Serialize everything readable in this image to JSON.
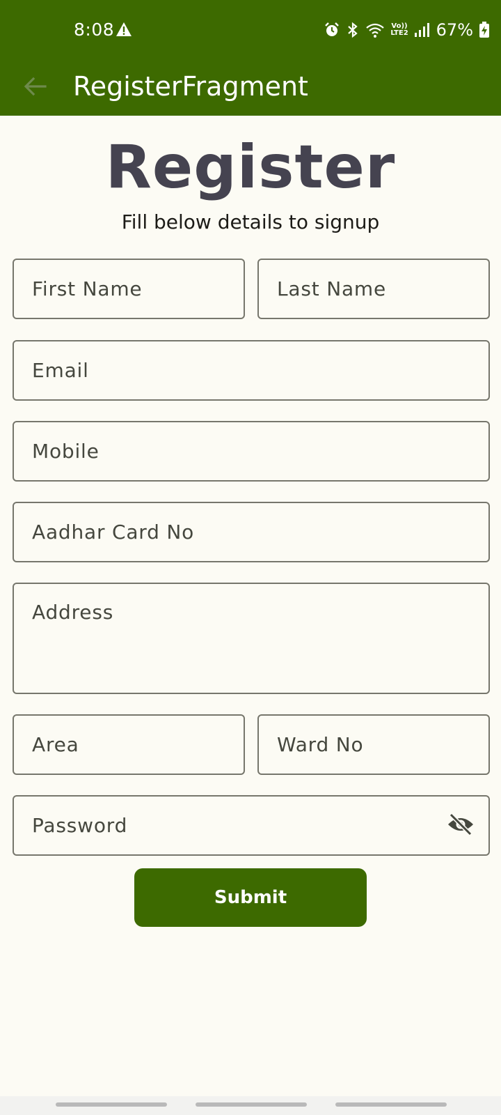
{
  "status_bar": {
    "time": "8:08",
    "battery": "67%",
    "volte_top": "Vo))",
    "volte_bottom": "LTE2"
  },
  "app_bar": {
    "title": "RegisterFragment"
  },
  "form": {
    "heading": "Register",
    "subheading": "Fill below details to signup",
    "first_name_placeholder": "First Name",
    "last_name_placeholder": "Last Name",
    "email_placeholder": "Email",
    "mobile_placeholder": "Mobile",
    "aadhar_placeholder": "Aadhar Card No",
    "address_placeholder": "Address",
    "area_placeholder": "Area",
    "ward_placeholder": "Ward No",
    "password_placeholder": "Password",
    "submit_label": "Submit"
  },
  "colors": {
    "primary": "#3d6a00",
    "background": "#fcfbf4",
    "heading": "#454350",
    "outline": "#76766c"
  },
  "icons": {
    "back": "arrow-back-icon",
    "password_toggle": "eye-off-icon",
    "warning": "warning-icon",
    "alarm": "alarm-icon",
    "bluetooth": "bluetooth-icon",
    "wifi": "wifi-icon",
    "signal": "signal-icon",
    "battery": "battery-charging-icon"
  }
}
